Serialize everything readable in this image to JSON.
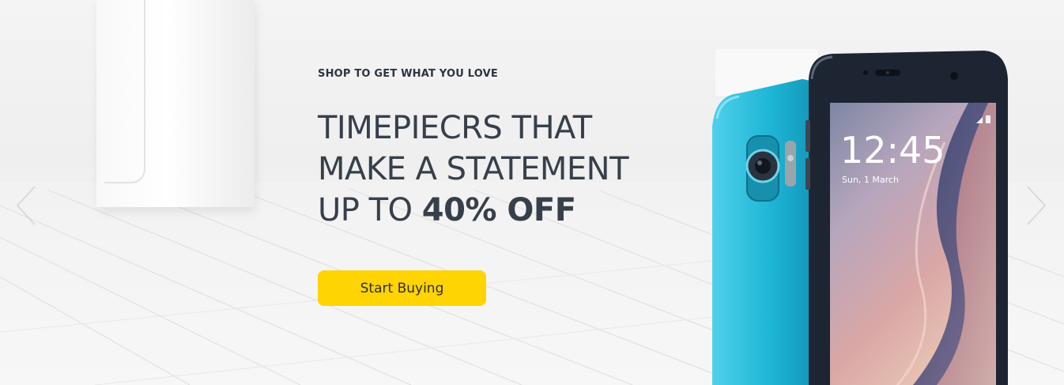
{
  "hero": {
    "eyebrow": "SHOP TO GET WHAT YOU LOVE",
    "headline": {
      "line1": "TIMEPIECRS THAT",
      "line2": "MAKE A STATEMENT",
      "line3_prefix": "UP TO ",
      "line3_emphasis": "40% OFF"
    },
    "cta_label": "Start Buying"
  },
  "phone": {
    "clock_time": "12:45",
    "clock_date": "Sun, 1 March"
  },
  "colors": {
    "accent": "#ffd400",
    "headline": "#37404a",
    "eyebrow": "#2b3540",
    "phone_blue": "#1fb6d6",
    "phone_dark": "#1e2532"
  },
  "icons": {
    "prev": "chevron-left-icon",
    "next": "chevron-right-icon"
  }
}
